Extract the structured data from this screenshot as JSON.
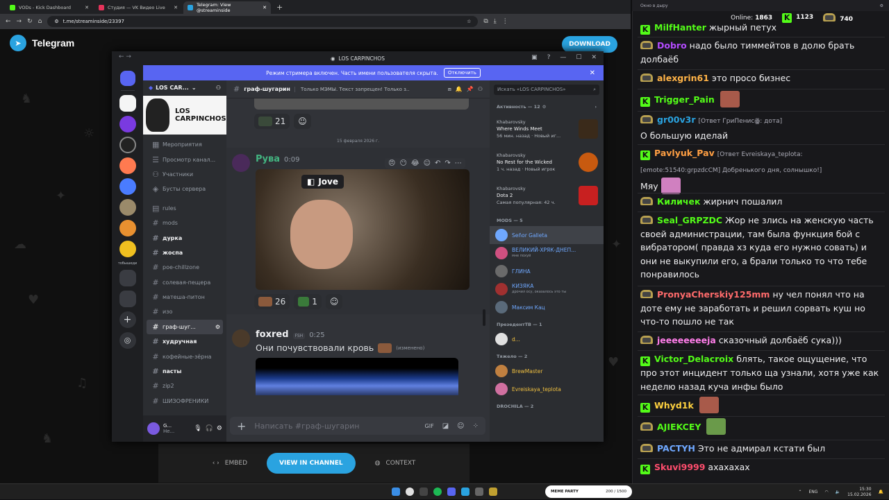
{
  "browser": {
    "tabs": [
      {
        "label": "VODs - Kick Dashboard",
        "color": "#53fc18"
      },
      {
        "label": "Студия — VK Видео Live",
        "color": "#e4335a"
      },
      {
        "label": "Telegram: View @streaminside",
        "color": "#2aa3e0"
      }
    ],
    "url": "t.me/streaminside/23397"
  },
  "telegram": {
    "brand": "Telegram",
    "download": "DOWNLOAD",
    "embed": "EMBED",
    "view": "VIEW IN CHANNEL",
    "context": "CONTEXT"
  },
  "discord": {
    "window_title": "LOS CARPINCHOS",
    "streamer_notice": "Режим стримера включен. Часть имени пользователя скрыта.",
    "disable": "Отключить",
    "server_name": "LOS CAR...",
    "banner": "LOS CARPINCHOS",
    "menu": [
      "Мероприятия",
      "Просмотр канал...",
      "Участники",
      "Бусты сервера"
    ],
    "channels": [
      {
        "name": "rules",
        "style": "muted"
      },
      {
        "name": "mods",
        "style": "muted"
      },
      {
        "name": "дурка",
        "style": "bold"
      },
      {
        "name": "жоспа",
        "style": "bold"
      },
      {
        "name": "poe-chillzone",
        "style": "muted"
      },
      {
        "name": "солевая-пещера",
        "style": "muted"
      },
      {
        "name": "матеша-питон",
        "style": "muted"
      },
      {
        "name": "изо",
        "style": "muted"
      },
      {
        "name": "граф-шуг...",
        "style": "selected"
      },
      {
        "name": "худручная",
        "style": "bold"
      },
      {
        "name": "кофейные-зёрна",
        "style": "muted"
      },
      {
        "name": "пасты",
        "style": "bold"
      },
      {
        "name": "zip2",
        "style": "muted"
      },
      {
        "name": "ШИЗОФРЕНИКИ",
        "style": "muted"
      }
    ],
    "user": {
      "name": "G...",
      "status": "Не..."
    },
    "channel_header": {
      "name": "граф-шугарин",
      "topic": "Только МЭМЫ. Текст запрещен! Только з..."
    },
    "search_placeholder": "Искать «LOS CARPINCHOS»",
    "reaction_top": "21",
    "date_divider": "15 февраля 2026 г.",
    "msg1": {
      "author": "Рува",
      "time": "0:09",
      "gif_label": "Jove",
      "reactions": [
        "26",
        "1"
      ]
    },
    "msg2": {
      "author": "foxred",
      "tag": "FSH",
      "time": "0:25",
      "text": "Они почувствовали кровь",
      "edited": "(изменено)"
    },
    "composer_placeholder": "Написать #граф-шугарин",
    "activity_header": "Активность — 12",
    "activities": [
      {
        "user": "Khabarovsky",
        "game": "Where Winds Meet",
        "meta": "56 мин. назад",
        "tag": "Новый иг...",
        "color": "#3a2a1a"
      },
      {
        "user": "Khabarovsky",
        "game": "No Rest for the Wicked",
        "meta": "1 ч. назад",
        "tag": "Новый игрок",
        "color": "#c85a10"
      },
      {
        "user": "Khabarovsky",
        "game": "Dota 2",
        "meta": "Самая популярная: 42 ч.",
        "tag": "",
        "color": "#c82020"
      }
    ],
    "mods_header": "MODS — 5",
    "mods": [
      {
        "name": "Señor Galleta",
        "sub": "",
        "color": "#6fa8ff"
      },
      {
        "name": "ВЕЛИКИЙ-ХРЯК-ДНЕП...",
        "sub": "мне похуй",
        "color": "#6fa8ff"
      },
      {
        "name": "ГЛИНА",
        "sub": "",
        "color": "#6fa8ff"
      },
      {
        "name": "КИЗЯКА",
        "sub": "дрочил осу, оказалось это ты",
        "color": "#6fa8ff"
      },
      {
        "name": "Максим Кац",
        "sub": "",
        "color": "#6fa8ff"
      }
    ],
    "president_header": "ПрезедентТВ — 1",
    "president": {
      "name": "d...",
      "color": "#f0c040"
    },
    "heavy_header": "Тяжело — 2",
    "heavy": [
      {
        "name": "BrewMaster",
        "color": "#f0c040"
      },
      {
        "name": "Evreiskaya_teplota",
        "color": "#f0c040"
      }
    ],
    "drochila_header": "DROCHILA — 2"
  },
  "chat": {
    "window_title": "Окно в дыру",
    "online_label": "Online:",
    "online": "1863",
    "kick": "1123",
    "vk": "740",
    "messages": [
      {
        "badge": "kick",
        "nick": "MilfHanter",
        "color": "#53fc18",
        "text": "жырный петух"
      },
      {
        "badge": "vk",
        "nick": "Dobro",
        "color": "#b44bff",
        "text": "надо было тиммейтов в долю брать долбаёб"
      },
      {
        "badge": "vk",
        "nick": "alexgrin61",
        "color": "#ffb347",
        "text": "это просо бизнес"
      },
      {
        "badge": "kick",
        "nick": "Trigger_Pain",
        "color": "#53fc18",
        "text": ""
      },
      {
        "badge": "vk",
        "nick": "gr00v3r",
        "color": "#2aa3e0",
        "reply": "[Ответ ГриПенисꙮ: дота]",
        "text": "О большую иделай"
      },
      {
        "badge": "kick",
        "nick": "Pavlyuk_Pav",
        "color": "#ff9f43",
        "reply": "[Ответ Evreiskaya_teplota: [emote:51540:grpzdcCM] Добренького дня, солнышко!]",
        "text": "Мяу"
      },
      {
        "badge": "vk",
        "nick": "Киличек",
        "color": "#53fc18",
        "text": "жирнич пошалил"
      },
      {
        "badge": "vk",
        "nick": "Seal_GRPZDC",
        "color": "#53fc18",
        "text": "Жор не злись на женскую часть своей администрации, там была функция бой с вибратором( правда хз куда его нужно совать) и они не выкупили его, а брали только то что тебе понравилось"
      },
      {
        "badge": "vk",
        "nick": "PronyaCherskiy125mm",
        "color": "#ff6b6b",
        "text": "ну чел понял что на доте ему не заработать и решил сорвать куш но что-то пошло не так"
      },
      {
        "badge": "vk",
        "nick": "jeeeeeeeeja",
        "color": "#ff7eea",
        "text": "сказочный долбаёб сука)))"
      },
      {
        "badge": "kick",
        "nick": "Victor_Delacroix",
        "color": "#53fc18",
        "text": "блять, такое ощущение, что про этот инцидент только ща узнали, хотя уже как неделю назад куча инфы было"
      },
      {
        "badge": "kick",
        "nick": "Whyd1k",
        "color": "#ffd23f",
        "text": ""
      },
      {
        "badge": "vk",
        "nick": "AJIEKCEY",
        "color": "#53fc18",
        "text": ""
      },
      {
        "badge": "vk",
        "nick": "PACTYH",
        "color": "#6fa8ff",
        "text": "Это не адмирал кстати был"
      },
      {
        "badge": "kick",
        "nick": "Skuvi9999",
        "color": "#ff4d6d",
        "text": "ахахахах"
      }
    ]
  },
  "taskbar": {
    "meme": "MEME PARTY",
    "meme_count": "200 / 1500",
    "lang": "ENG",
    "time": "15:30",
    "date": "15.02.2026"
  }
}
